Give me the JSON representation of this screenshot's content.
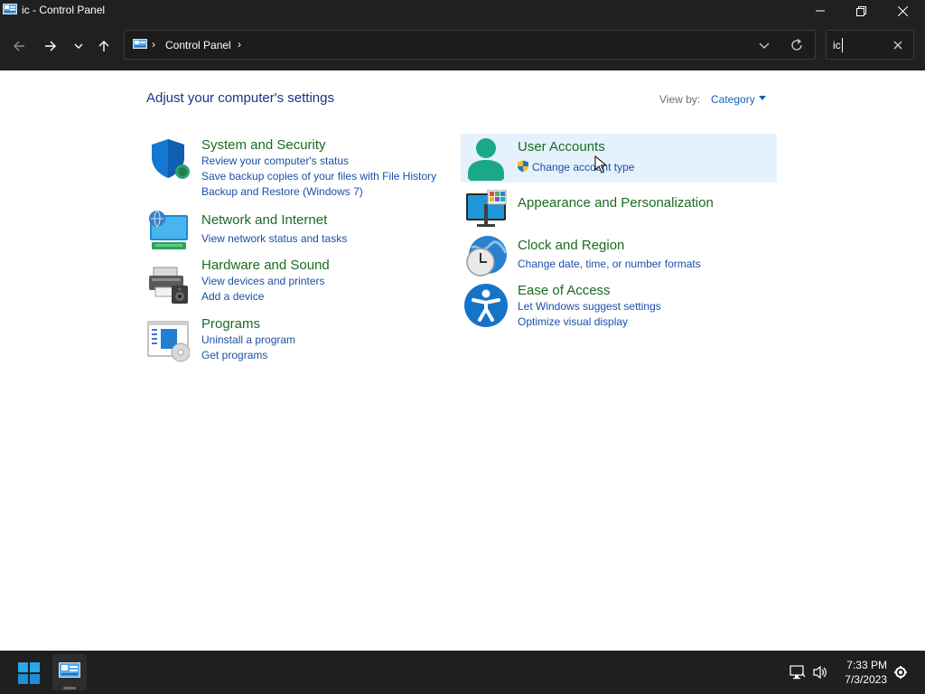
{
  "window": {
    "title": "ic - Control Panel"
  },
  "address_bar": {
    "breadcrumb": "Control Panel",
    "separator": "›"
  },
  "search": {
    "value": "ic"
  },
  "main": {
    "heading": "Adjust your computer's settings",
    "view_by_label": "View by:",
    "view_by_value": "Category"
  },
  "categories": [
    {
      "title": "System and Security",
      "icon": "shield-icon",
      "links": [
        "Review your computer's status",
        "Save backup copies of your files with File History",
        "Backup and Restore (Windows 7)"
      ]
    },
    {
      "title": "Network and Internet",
      "icon": "network-globe-icon",
      "links": [
        "View network status and tasks"
      ]
    },
    {
      "title": "Hardware and Sound",
      "icon": "printer-speaker-icon",
      "links": [
        "View devices and printers",
        "Add a device"
      ]
    },
    {
      "title": "Programs",
      "icon": "programs-disc-icon",
      "links": [
        "Uninstall a program",
        "Get programs"
      ]
    },
    {
      "title": "User Accounts",
      "icon": "user-icon",
      "links": [
        "Change account type"
      ],
      "link_icon": "uac-shield-icon"
    },
    {
      "title": "Appearance and Personalization",
      "icon": "monitor-palette-icon",
      "links": []
    },
    {
      "title": "Clock and Region",
      "icon": "clock-globe-icon",
      "links": [
        "Change date, time, or number formats"
      ]
    },
    {
      "title": "Ease of Access",
      "icon": "accessibility-icon",
      "links": [
        "Let Windows suggest settings",
        "Optimize visual display"
      ]
    }
  ],
  "taskbar": {
    "time": "7:33 PM",
    "date": "7/3/2023"
  },
  "colors": {
    "title_green": "#1a6b23",
    "link_blue": "#1c4fa7",
    "heading_blue": "#1e3287",
    "hover_bg": "#e5f1fb",
    "chrome_dark": "#202020"
  }
}
